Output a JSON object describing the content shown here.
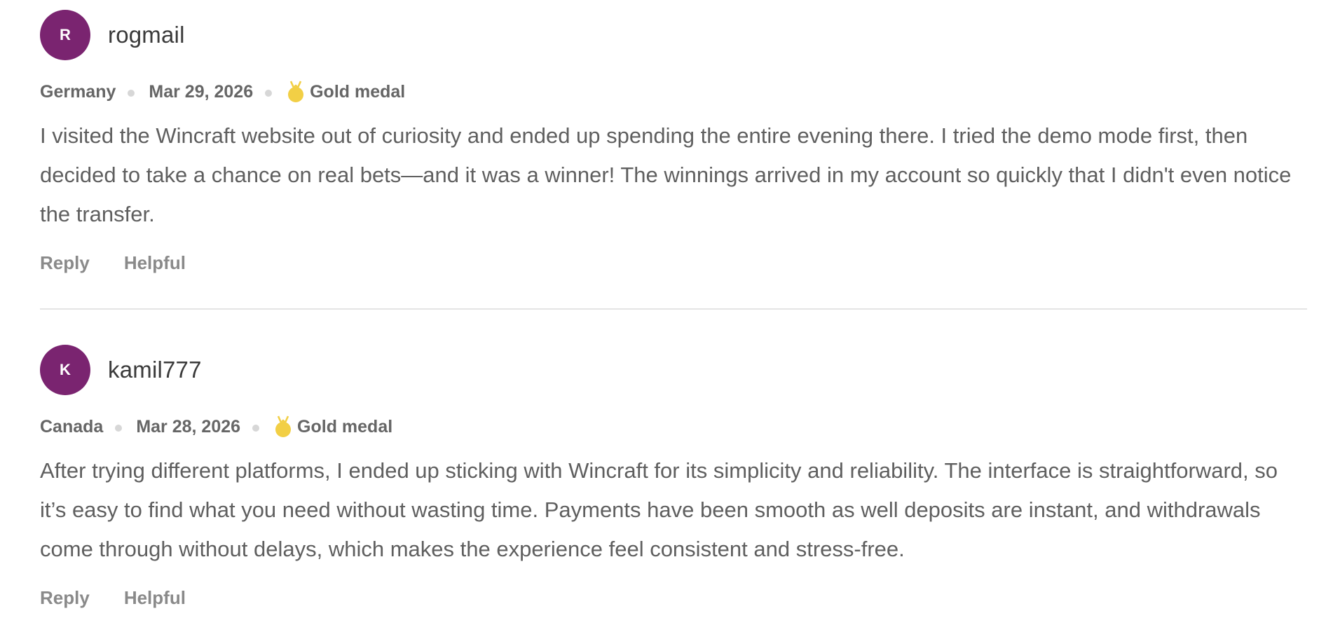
{
  "reviews": [
    {
      "avatar_initial": "R",
      "avatar_color": "#7a2470",
      "username": "rogmail",
      "country": "Germany",
      "date": "Mar 29, 2026",
      "medal_icon": "gold-medal-icon",
      "medal_label": "Gold medal",
      "text": "I visited the Wincraft website out of curiosity and ended up spending the entire evening there. I tried the demo mode first, then decided to take a chance on real bets—and it was a winner! The winnings arrived in my account so quickly that I didn't even notice the transfer.",
      "reply_label": "Reply",
      "helpful_label": "Helpful"
    },
    {
      "avatar_initial": "K",
      "avatar_color": "#7a2470",
      "username": "kamil777",
      "country": "Canada",
      "date": "Mar 28, 2026",
      "medal_icon": "gold-medal-icon",
      "medal_label": "Gold medal",
      "text": "After trying different platforms, I ended up sticking with Wincraft for its simplicity and reliability. The interface is straightforward, so it’s easy to find what you need without wasting time. Payments have been smooth as well deposits are instant, and withdrawals come through without delays, which makes the experience feel consistent and stress-free.",
      "reply_label": "Reply",
      "helpful_label": "Helpful"
    }
  ],
  "colors": {
    "avatar": "#7a2470",
    "medal": "#f2cf45",
    "divider": "#e4e4e4"
  }
}
